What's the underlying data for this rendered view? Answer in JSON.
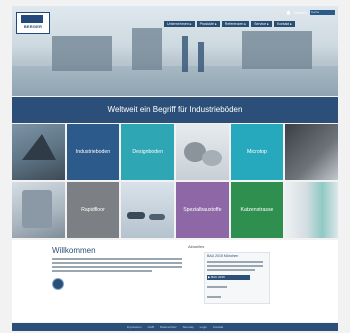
{
  "header": {
    "logo_text": "BERGER",
    "utility": {
      "language": "Deutsch",
      "search_placeholder": "Suche"
    },
    "nav": [
      {
        "label": "Unternehmen ▸"
      },
      {
        "label": "Produkte ▸"
      },
      {
        "label": "Referenzen ▸"
      },
      {
        "label": "Service ▸"
      },
      {
        "label": "Kontakt ▸"
      }
    ]
  },
  "banner": {
    "title": "Weltweit ein Begriff für Industrieböden"
  },
  "tiles": [
    {
      "label": ""
    },
    {
      "label": "Industrieboden"
    },
    {
      "label": "Designboden"
    },
    {
      "label": ""
    },
    {
      "label": "Microtop"
    },
    {
      "label": ""
    },
    {
      "label": ""
    },
    {
      "label": "Rapidfloor"
    },
    {
      "label": ""
    },
    {
      "label": "Spezialbaustoffe"
    },
    {
      "label": "Katzenstrasse"
    },
    {
      "label": ""
    }
  ],
  "welcome": {
    "title": "Willkommen"
  },
  "news": {
    "heading": "Aktuelles",
    "title": "BAU 2015 München",
    "button": "▶ BAU 2015"
  },
  "footer": {
    "links": [
      "Impressum",
      "AGB",
      "Datenschutz",
      "Sitemap",
      "Login",
      "Kontakt"
    ]
  },
  "colors": {
    "primary": "#2b4f78",
    "teal": "#2ea6b4",
    "purple": "#8e67a6",
    "green": "#2f8f4e"
  }
}
